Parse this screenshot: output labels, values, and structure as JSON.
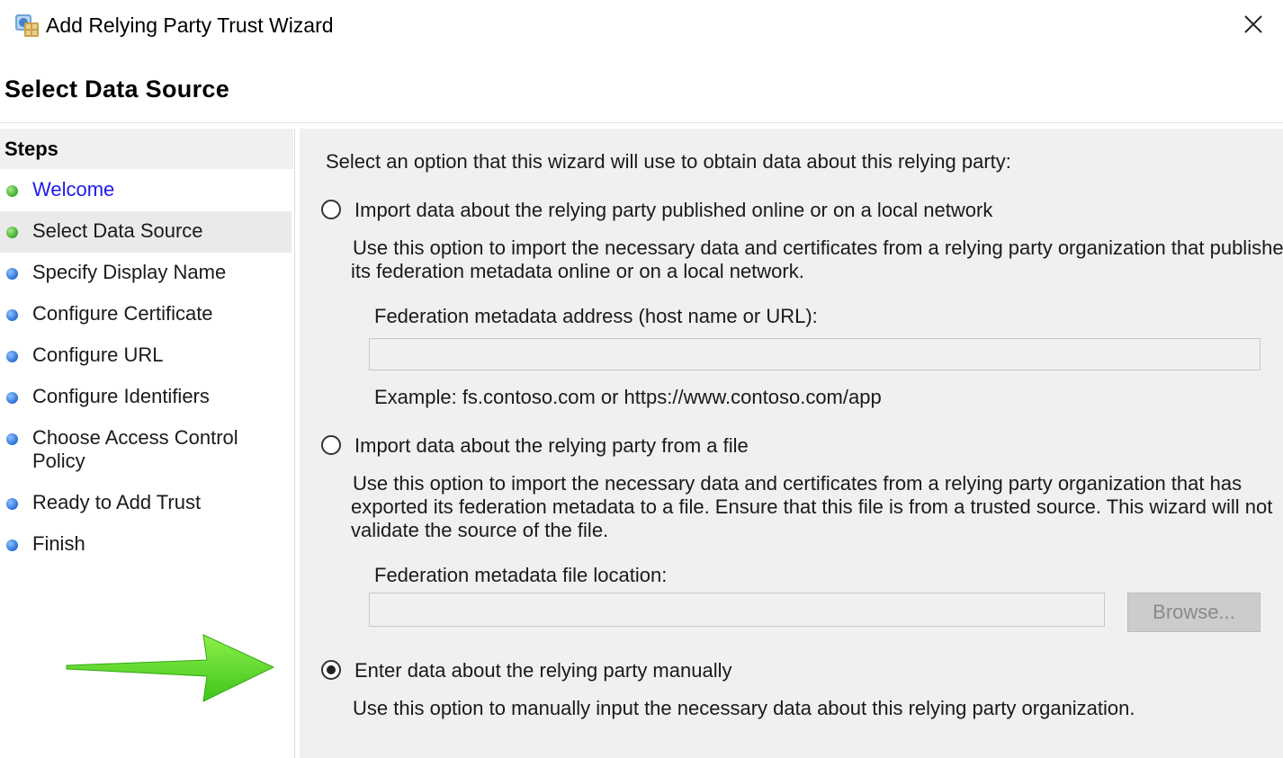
{
  "window": {
    "title": "Add Relying Party Trust Wizard",
    "close_glyph": "✕"
  },
  "page_title": "Select Data Source",
  "steps": {
    "header": "Steps",
    "items": [
      {
        "label": "Welcome",
        "status": "done",
        "link": true
      },
      {
        "label": "Select Data Source",
        "status": "current"
      },
      {
        "label": "Specify Display Name",
        "status": "pending"
      },
      {
        "label": "Configure Certificate",
        "status": "pending"
      },
      {
        "label": "Configure URL",
        "status": "pending"
      },
      {
        "label": "Configure Identifiers",
        "status": "pending"
      },
      {
        "label": "Choose Access Control",
        "label_line2": "Policy",
        "status": "pending"
      },
      {
        "label": "Ready to Add Trust",
        "status": "pending"
      },
      {
        "label": "Finish",
        "status": "pending"
      }
    ]
  },
  "main": {
    "intro": "Select an option that this wizard will use to obtain data about this relying party:",
    "option_online": {
      "label": "Import data about the relying party published online or on a local network",
      "desc_line1": "Use this option to import the necessary data and certificates from a relying party organization that publishes",
      "desc_line2": "its federation metadata online or on a local network.",
      "field_label": "Federation metadata address (host name or URL):",
      "field_value": "",
      "example": "Example: fs.contoso.com or https://www.contoso.com/app",
      "selected": false
    },
    "option_file": {
      "label": "Import data about the relying party from a file",
      "desc_line1": "Use this option to import the necessary data and certificates from a relying party organization that has",
      "desc_line2": "exported its federation metadata to a file. Ensure that this file is from a trusted source.  This wizard will not",
      "desc_line3": "validate the source of the file.",
      "field_label": "Federation metadata file location:",
      "field_value": "",
      "browse_label": "Browse...",
      "selected": false
    },
    "option_manual": {
      "label": "Enter data about the relying party manually",
      "desc": "Use this option to manually input the necessary data about this relying party organization.",
      "selected": true
    }
  },
  "colors": {
    "done_dot": "#3eaa2b",
    "pending_dot": "#2a6fd6",
    "link": "#1c1cf0",
    "annotation_arrow": "#55dd22"
  }
}
